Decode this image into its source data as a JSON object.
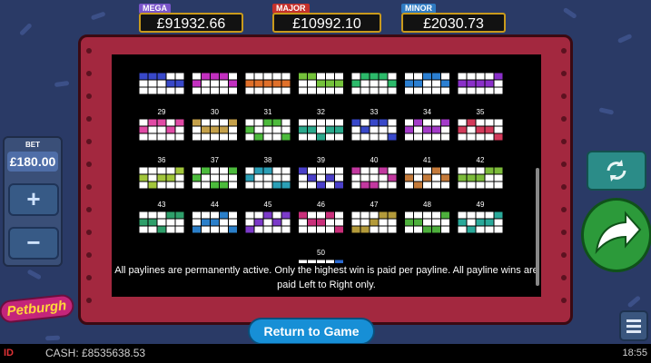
{
  "jackpots": [
    {
      "tag": "MEGA",
      "value": "£91932.66",
      "color": "#7a55c9"
    },
    {
      "tag": "MAJOR",
      "value": "£10992.10",
      "color": "#c4302b"
    },
    {
      "tag": "MINOR",
      "value": "£2030.73",
      "color": "#2f7bc2"
    }
  ],
  "bet": {
    "label": "BET",
    "amount": "£180.00",
    "plus": "+",
    "minus": "−"
  },
  "paylines": {
    "cell_color_on": "#ffffff",
    "grid_border": "#ffffff",
    "items": [
      {
        "num": "",
        "color": "#3848c9"
      },
      {
        "num": "",
        "color": "#c22fbf"
      },
      {
        "num": "",
        "color": "#e0702a"
      },
      {
        "num": "",
        "color": "#74c23a"
      },
      {
        "num": "",
        "color": "#2cba6a"
      },
      {
        "num": "",
        "color": "#2b7fd1"
      },
      {
        "num": "",
        "color": "#8a2fc9"
      },
      {
        "num": "29",
        "color": "#e14aa5"
      },
      {
        "num": "30",
        "color": "#c4a04a"
      },
      {
        "num": "31",
        "color": "#4dbb3c"
      },
      {
        "num": "32",
        "color": "#2aa98c"
      },
      {
        "num": "33",
        "color": "#3848c9"
      },
      {
        "num": "34",
        "color": "#a43ac9"
      },
      {
        "num": "35",
        "color": "#d33a5a"
      },
      {
        "num": "36",
        "color": "#a2c63b"
      },
      {
        "num": "37",
        "color": "#4cbb3c"
      },
      {
        "num": "38",
        "color": "#2b9fb6"
      },
      {
        "num": "39",
        "color": "#4a3fc9"
      },
      {
        "num": "40",
        "color": "#c2389f"
      },
      {
        "num": "41",
        "color": "#c47a3a"
      },
      {
        "num": "42",
        "color": "#7cbb3a"
      },
      {
        "num": "43",
        "color": "#2e9f6a"
      },
      {
        "num": "44",
        "color": "#2b7fc9"
      },
      {
        "num": "45",
        "color": "#7c3ac9"
      },
      {
        "num": "46",
        "color": "#c92f7a"
      },
      {
        "num": "47",
        "color": "#b39a3a"
      },
      {
        "num": "48",
        "color": "#4daf3c"
      },
      {
        "num": "49",
        "color": "#2aa99a"
      },
      {
        "num": "50",
        "color": "#2b6ad1"
      }
    ]
  },
  "rules_text": "All paylines are permanently active. Only the highest win is paid per payline. All payline wins are paid Left to Right only.",
  "return_button": "Return to Game",
  "logo_text": "Petburgh",
  "brand_text": "ID",
  "cash": "CASH: £8535638.53",
  "clock": "18:55",
  "icons": {
    "spin": "arrow-icon",
    "autoplay": "refresh-icon",
    "menu": "menu-icon"
  }
}
